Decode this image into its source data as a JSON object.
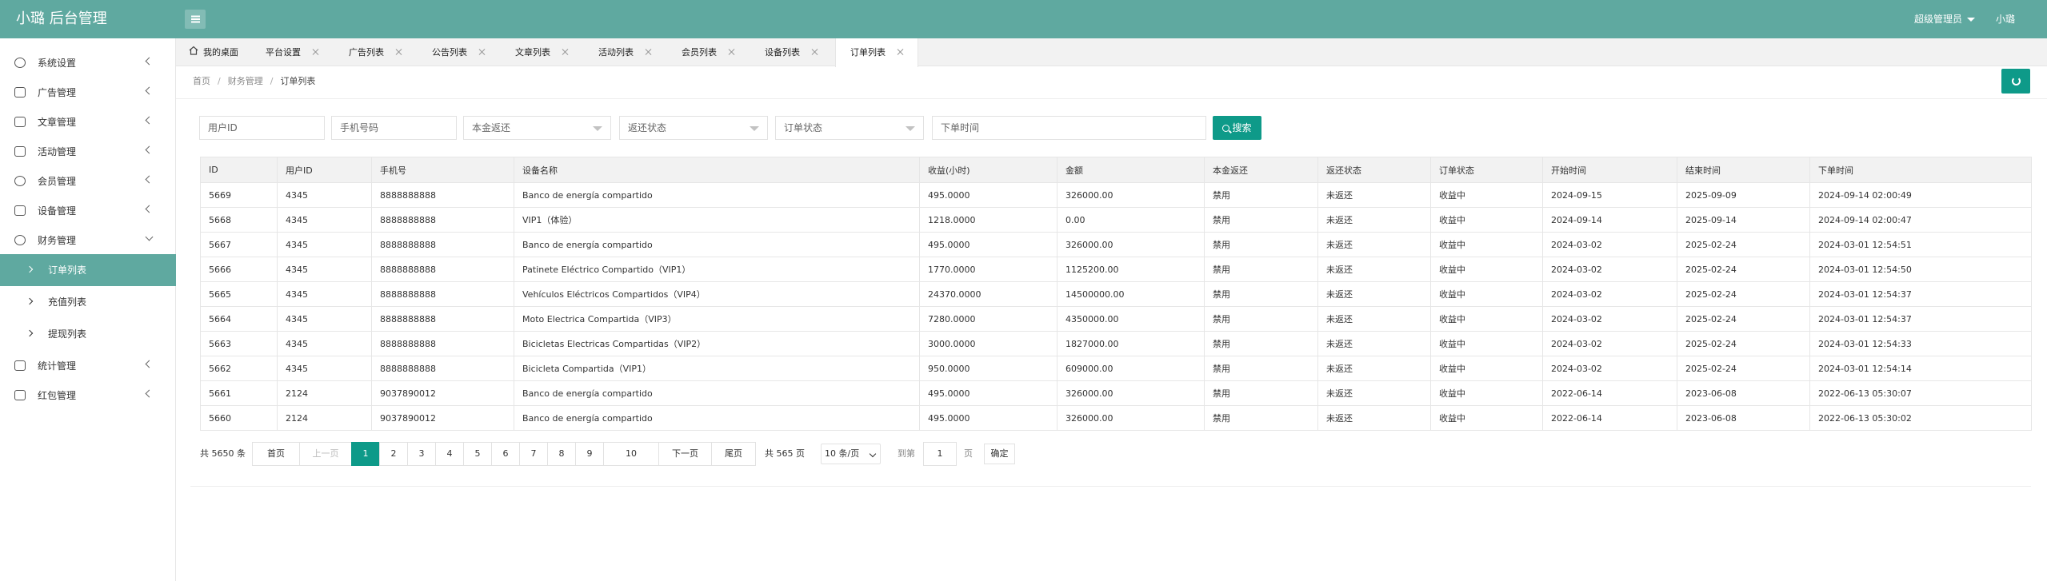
{
  "app": {
    "title": "小璐 后台管理"
  },
  "header": {
    "role": "超级管理员",
    "user": "小璐"
  },
  "sidebar": {
    "items": [
      {
        "label": "系统设置",
        "icon": "gear-icon"
      },
      {
        "label": "广告管理",
        "icon": "image-icon"
      },
      {
        "label": "文章管理",
        "icon": "car-icon"
      },
      {
        "label": "活动管理",
        "icon": "calendar-icon"
      },
      {
        "label": "会员管理",
        "icon": "user-icon"
      },
      {
        "label": "设备管理",
        "icon": "shuffle-icon"
      },
      {
        "label": "财务管理",
        "icon": "money-icon"
      },
      {
        "label": "统计管理",
        "icon": "pulse-icon"
      },
      {
        "label": "红包管理",
        "icon": "gift-icon"
      }
    ],
    "finance_sub": [
      {
        "label": "订单列表",
        "active": true
      },
      {
        "label": "充值列表",
        "active": false
      },
      {
        "label": "提现列表",
        "active": false
      }
    ]
  },
  "tabs": [
    {
      "label": "我的桌面",
      "icon": "home-icon"
    },
    {
      "label": "平台设置"
    },
    {
      "label": "广告列表"
    },
    {
      "label": "公告列表"
    },
    {
      "label": "文章列表"
    },
    {
      "label": "活动列表"
    },
    {
      "label": "会员列表"
    },
    {
      "label": "设备列表"
    },
    {
      "label": "订单列表",
      "active": true
    }
  ],
  "breadcrumb": [
    "首页",
    "财务管理",
    "订单列表"
  ],
  "filters": {
    "user_id_placeholder": "用户ID",
    "phone_placeholder": "手机号码",
    "principal_return": "本金返还",
    "return_status": "返还状态",
    "order_status": "订单状态",
    "order_time_placeholder": "下单时间",
    "search_label": "搜索"
  },
  "table": {
    "columns": [
      "ID",
      "用户ID",
      "手机号",
      "设备名称",
      "收益(小时)",
      "金额",
      "本金返还",
      "返还状态",
      "订单状态",
      "开始时间",
      "结束时间",
      "下单时间"
    ],
    "rows": [
      [
        "5669",
        "4345",
        "8888888888",
        "Banco de energía compartido",
        "495.0000",
        "326000.00",
        "禁用",
        "未返还",
        "收益中",
        "2024-09-15",
        "2025-09-09",
        "2024-09-14 02:00:49"
      ],
      [
        "5668",
        "4345",
        "8888888888",
        "VIP1（体验）",
        "1218.0000",
        "0.00",
        "禁用",
        "未返还",
        "收益中",
        "2024-09-14",
        "2025-09-14",
        "2024-09-14 02:00:47"
      ],
      [
        "5667",
        "4345",
        "8888888888",
        "Banco de energía compartido",
        "495.0000",
        "326000.00",
        "禁用",
        "未返还",
        "收益中",
        "2024-03-02",
        "2025-02-24",
        "2024-03-01 12:54:51"
      ],
      [
        "5666",
        "4345",
        "8888888888",
        "Patinete Eléctrico Compartido（VIP1）",
        "1770.0000",
        "1125200.00",
        "禁用",
        "未返还",
        "收益中",
        "2024-03-02",
        "2025-02-24",
        "2024-03-01 12:54:50"
      ],
      [
        "5665",
        "4345",
        "8888888888",
        "Vehículos Eléctricos Compartidos（VIP4）",
        "24370.0000",
        "14500000.00",
        "禁用",
        "未返还",
        "收益中",
        "2024-03-02",
        "2025-02-24",
        "2024-03-01 12:54:37"
      ],
      [
        "5664",
        "4345",
        "8888888888",
        "Moto Electrica Compartida（VIP3）",
        "7280.0000",
        "4350000.00",
        "禁用",
        "未返还",
        "收益中",
        "2024-03-02",
        "2025-02-24",
        "2024-03-01 12:54:37"
      ],
      [
        "5663",
        "4345",
        "8888888888",
        "Bicicletas Electricas Compartidas（VIP2）",
        "3000.0000",
        "1827000.00",
        "禁用",
        "未返还",
        "收益中",
        "2024-03-02",
        "2025-02-24",
        "2024-03-01 12:54:33"
      ],
      [
        "5662",
        "4345",
        "8888888888",
        "Bicicleta Compartida（VIP1）",
        "950.0000",
        "609000.00",
        "禁用",
        "未返还",
        "收益中",
        "2024-03-02",
        "2025-02-24",
        "2024-03-01 12:54:14"
      ],
      [
        "5661",
        "2124",
        "9037890012",
        "Banco de energía compartido",
        "495.0000",
        "326000.00",
        "禁用",
        "未返还",
        "收益中",
        "2022-06-14",
        "2023-06-08",
        "2022-06-13 05:30:07"
      ],
      [
        "5660",
        "2124",
        "9037890012",
        "Banco de energía compartido",
        "495.0000",
        "326000.00",
        "禁用",
        "未返还",
        "收益中",
        "2022-06-14",
        "2023-06-08",
        "2022-06-13 05:30:02"
      ]
    ]
  },
  "pagination": {
    "total": "共 5650 条",
    "first": "首页",
    "prev": "上一页",
    "pages": [
      "1",
      "2",
      "3",
      "4",
      "5",
      "6",
      "7",
      "8",
      "9",
      "10"
    ],
    "current": "1",
    "next": "下一页",
    "last": "尾页",
    "page_count": "共 565 页",
    "page_size": "10 条/页",
    "goto_prefix": "到第",
    "goto_value": "1",
    "goto_suffix": "页",
    "confirm": "确定"
  },
  "colors": {
    "primary": "#5fa9a0",
    "button": "#0e9a89",
    "status_green": "#3aa048",
    "muted": "#bbbbbb"
  }
}
